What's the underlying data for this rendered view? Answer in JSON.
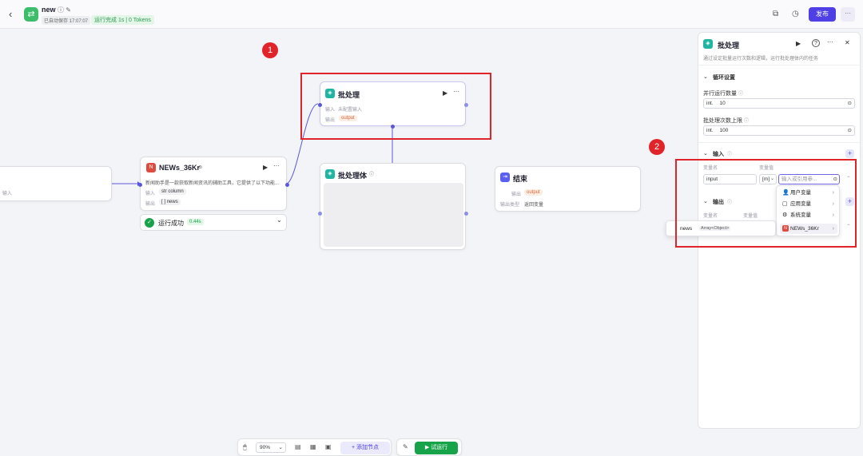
{
  "topbar": {
    "back": "‹",
    "logo": "⇄",
    "app_name": "new",
    "app_name_icons": "ⓘ ✎",
    "saved_text": "已自动保存 17:07:07",
    "run_status": "运行完成 1s | 0 Tokens",
    "copy_icon": "⧉",
    "history_icon": "◷",
    "publish_label": "发布",
    "more_label": "···"
  },
  "annotations": {
    "circle1": "1",
    "circle2": "2"
  },
  "nodes": {
    "left_partial": {
      "input_label": "输入"
    },
    "news": {
      "icon": "N",
      "title": "NEWs_36Kr",
      "title_icon": "⊜",
      "run": "▶",
      "more": "···",
      "desc": "新闻助手是一款获取新闻资讯的辅助工具，它提供了以下功能...",
      "input_label": "输入",
      "input_type": "str",
      "input_value": "column",
      "output_label": "输出",
      "output_type": "[ ]",
      "output_value": "news"
    },
    "status": {
      "icon": "✓",
      "text": "运行成功",
      "time": "0.44s",
      "chevron": "⌄"
    },
    "batch": {
      "icon": "◈",
      "title": "批处理",
      "run": "▶",
      "more": "···",
      "input_label": "输入",
      "input_value": "未配置输入",
      "output_label": "输出",
      "output_value": "output"
    },
    "batch_body": {
      "icon": "◈",
      "title": "批处理体",
      "info_icon": "ⓘ"
    },
    "end": {
      "icon": "⇥",
      "title": "结束",
      "output_label": "输出",
      "output_value": "output",
      "type_label": "输出类型",
      "type_value": "返回变量"
    }
  },
  "panel": {
    "icon": "◈",
    "title": "批处理",
    "run": "▶",
    "help": "?",
    "more": "···",
    "close": "✕",
    "desc": "通过设定批量运行次数和逻辑，运行批处理体内的任务",
    "loop_section": "循环设置",
    "parallel_label": "并行运行数量",
    "parallel_type": "int.",
    "parallel_value": "10",
    "batch_limit_label": "批处理次数上限",
    "batch_limit_type": "int.",
    "batch_limit_value": "100",
    "input_section": "输入",
    "var_name_header": "变量名",
    "var_value_header": "变量值",
    "input_name": "input",
    "input_type": "[m]",
    "input_placeholder": "输入或引用参...",
    "output_section": "输出",
    "output_var_name_header": "变量名",
    "output_var_value_header": "变量值",
    "add": "+",
    "remove": "−",
    "caret": "⌄",
    "info_icon": "ⓘ"
  },
  "dropdown": {
    "items": [
      {
        "icon": "👤",
        "label": "用户变量"
      },
      {
        "icon": "▢",
        "label": "应用变量"
      },
      {
        "icon": "⚙",
        "label": "系统变量"
      },
      {
        "icon": "N",
        "label": "NEWs_36Kr"
      }
    ],
    "arrow": "›"
  },
  "submenu": {
    "name": "news",
    "type": "Array<Object>"
  },
  "bottom_bar": {
    "mouse_icon": "🖱",
    "zoom": "90%",
    "zoom_caret": "⌄",
    "note_icon": "▤",
    "layout_icon": "▦",
    "minimap_icon": "▣",
    "add_node": "+ 添加节点",
    "pointer_icon": "✎",
    "trial_run": "▶ 试运行"
  },
  "colors": {
    "accent": "#4e40e5",
    "node_teal": "#1fb5a2",
    "node_red": "#e04a3f",
    "end_purple": "#5b5ff0",
    "success_green": "#16a34a",
    "annotation_red": "#e0242a"
  }
}
